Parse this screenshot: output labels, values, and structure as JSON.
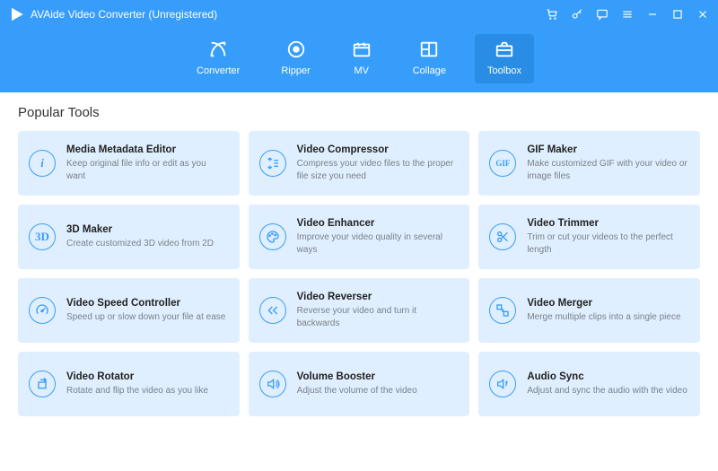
{
  "app": {
    "title": "AVAide Video Converter (Unregistered)"
  },
  "titleControls": {
    "cart": "cart-icon",
    "key": "key-icon",
    "chat": "chat-icon",
    "menu": "menu-icon",
    "minimize": "minimize-icon",
    "maximize": "maximize-icon",
    "close": "close-icon"
  },
  "nav": [
    {
      "id": "converter",
      "label": "Converter",
      "active": false
    },
    {
      "id": "ripper",
      "label": "Ripper",
      "active": false
    },
    {
      "id": "mv",
      "label": "MV",
      "active": false
    },
    {
      "id": "collage",
      "label": "Collage",
      "active": false
    },
    {
      "id": "toolbox",
      "label": "Toolbox",
      "active": true
    }
  ],
  "sectionTitle": "Popular Tools",
  "tools": [
    {
      "icon": "info-icon",
      "glyph": "i",
      "title": "Media Metadata Editor",
      "desc": "Keep original file info or edit as you want"
    },
    {
      "icon": "compress-icon",
      "glyph": "svg-compress",
      "title": "Video Compressor",
      "desc": "Compress your video files to the proper file size you need"
    },
    {
      "icon": "gif-icon",
      "glyph": "GIF",
      "title": "GIF Maker",
      "desc": "Make customized GIF with your video or image files"
    },
    {
      "icon": "3d-icon",
      "glyph": "3D",
      "title": "3D Maker",
      "desc": "Create customized 3D video from 2D"
    },
    {
      "icon": "palette-icon",
      "glyph": "svg-palette",
      "title": "Video Enhancer",
      "desc": "Improve your video quality in several ways"
    },
    {
      "icon": "scissors-icon",
      "glyph": "svg-scissors",
      "title": "Video Trimmer",
      "desc": "Trim or cut your videos to the perfect length"
    },
    {
      "icon": "speed-icon",
      "glyph": "svg-speed",
      "title": "Video Speed Controller",
      "desc": "Speed up or slow down your file at ease"
    },
    {
      "icon": "reverse-icon",
      "glyph": "svg-reverse",
      "title": "Video Reverser",
      "desc": "Reverse your video and turn it backwards"
    },
    {
      "icon": "merge-icon",
      "glyph": "svg-merge",
      "title": "Video Merger",
      "desc": "Merge multiple clips into a single piece"
    },
    {
      "icon": "rotate-icon",
      "glyph": "svg-rotate",
      "title": "Video Rotator",
      "desc": "Rotate and flip the video as you like"
    },
    {
      "icon": "volume-icon",
      "glyph": "svg-volume",
      "title": "Volume Booster",
      "desc": "Adjust the volume of the video"
    },
    {
      "icon": "sync-icon",
      "glyph": "svg-sync",
      "title": "Audio Sync",
      "desc": "Adjust and sync the audio with the video"
    }
  ],
  "colors": {
    "brand": "#379dfa",
    "cardBg": "#e0efff"
  }
}
